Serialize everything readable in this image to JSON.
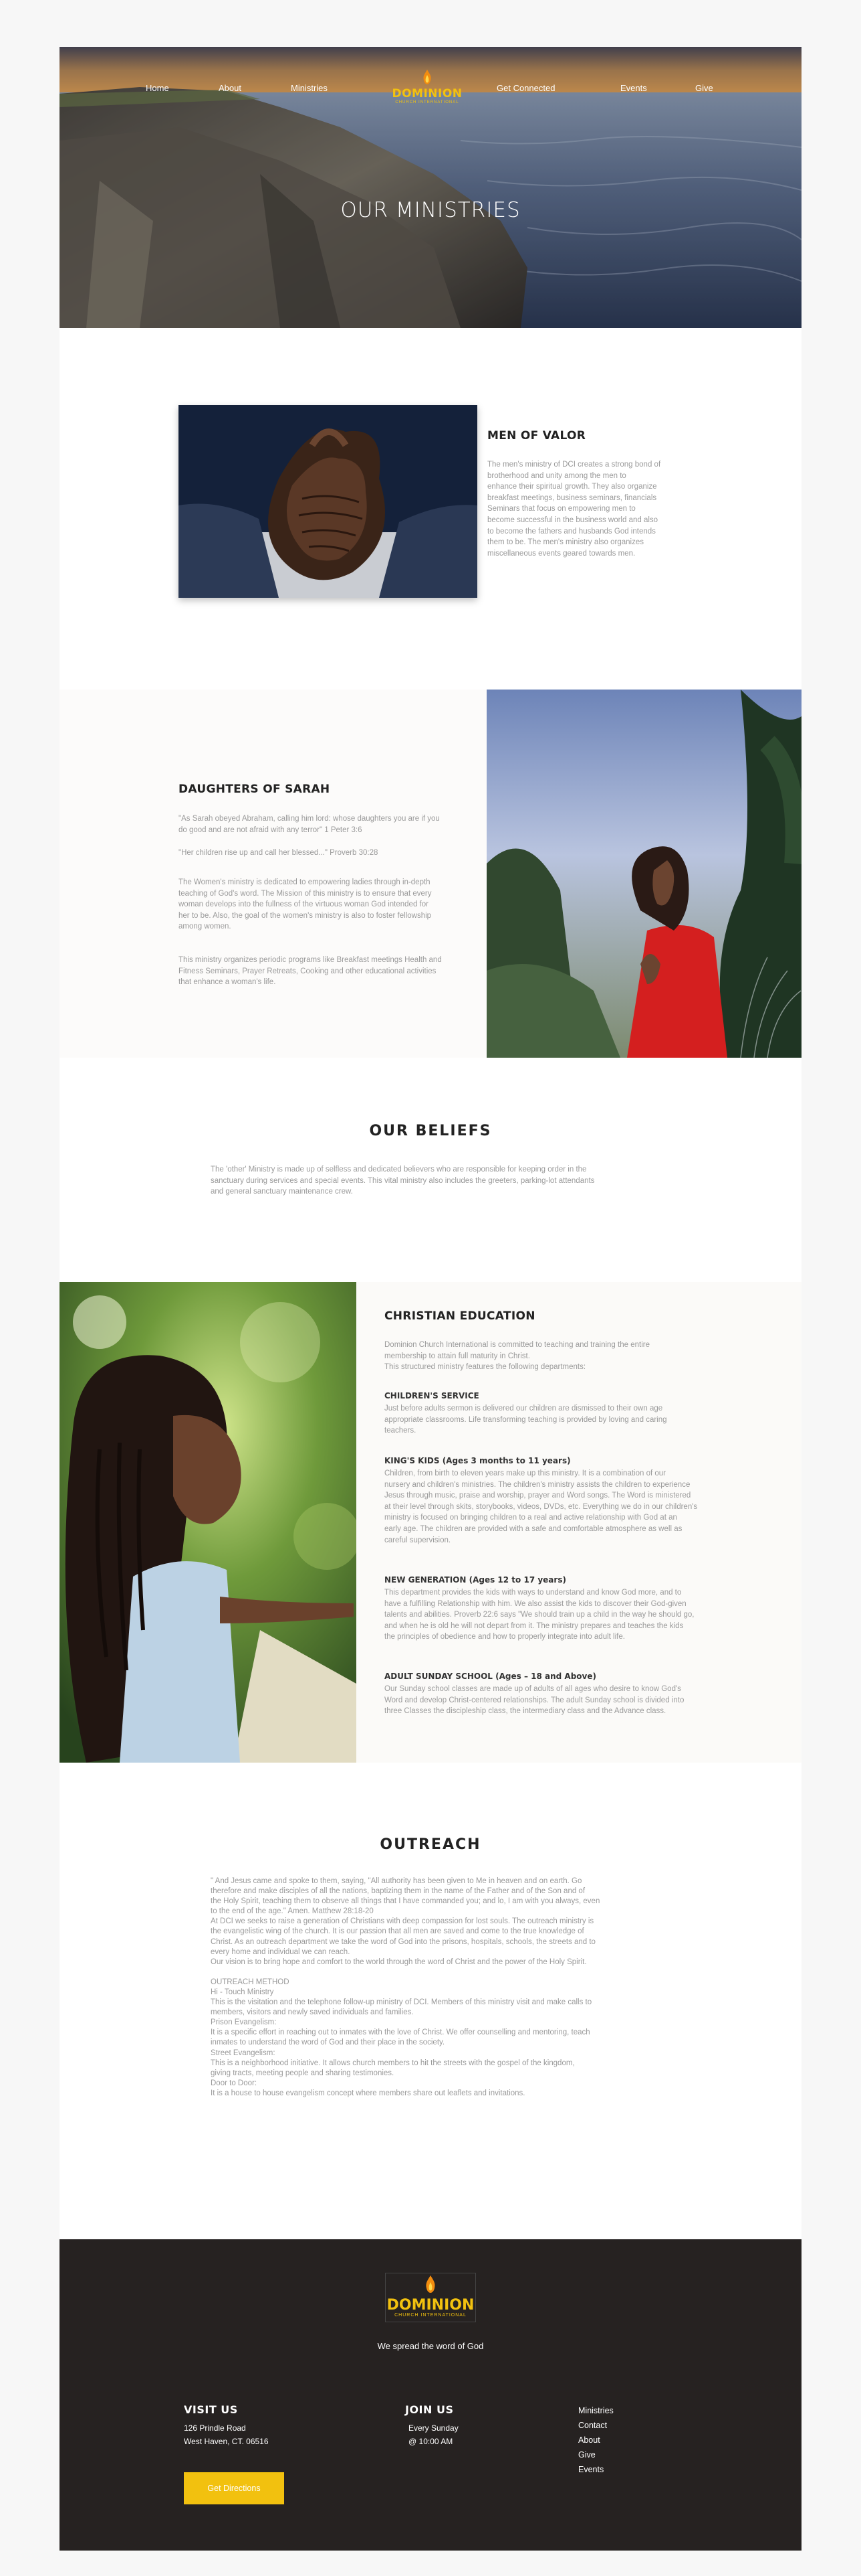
{
  "nav": {
    "items": [
      "Home",
      "About",
      "Ministries",
      "Get Connected",
      "Events",
      "Give"
    ]
  },
  "logo": {
    "word": "DOMINION",
    "sub": "CHURCH INTERNATIONAL"
  },
  "hero": {
    "title": "OUR MINISTRIES"
  },
  "men": {
    "title": "MEN OF VALOR",
    "lines": [
      "The men's ministry of DCI creates a strong bond of",
      "brotherhood and unity among the men to",
      "enhance their spiritual growth. They also organize",
      "breakfast meetings, business seminars, financials",
      "Seminars that focus on empowering men to",
      "become successful in the business world and also",
      "to become the fathers and husbands God intends",
      "them to be. The men's ministry also organizes",
      "miscellaneous events geared towards men."
    ]
  },
  "daughters": {
    "title": "DAUGHTERS OF SARAH",
    "quote1": [
      "\"As Sarah obeyed Abraham, calling him lord: whose daughters you are if you",
      "do good and are not afraid with any terror\" 1 Peter 3:6"
    ],
    "quote2": "\"Her children rise up and call her blessed...\" Proverb 30:28",
    "body1": [
      "The Women's ministry is dedicated to empowering ladies through in-depth",
      "teaching of God's word. The Mission of this ministry is to ensure that every",
      "woman develops into the fullness of the virtuous woman God intended for",
      "her to be. Also, the goal of the women's ministry is also to foster fellowship",
      "among women."
    ],
    "body2": [
      "This ministry organizes periodic programs like Breakfast meetings Health and",
      "Fitness Seminars, Prayer Retreats, Cooking and other educational activities",
      "that enhance a woman's life."
    ]
  },
  "beliefs": {
    "title": "OUR BELIEFS",
    "lines": [
      "The 'other' Ministry is made up of selfless and dedicated believers who are responsible for keeping order in the",
      "sanctuary during services and special events. This vital ministry also includes the greeters, parking-lot attendants",
      "and general sanctuary maintenance crew."
    ]
  },
  "education": {
    "title": "CHRISTIAN EDUCATION",
    "intro": [
      "Dominion Church International is committed to teaching and training the entire",
      "membership to attain full maturity in Christ.",
      "This structured ministry features the following departments:"
    ],
    "sections": [
      {
        "head": "CHILDREN'S SERVICE",
        "lines": [
          "Just before adults sermon is delivered our children are dismissed to their own age",
          "appropriate classrooms. Life transforming teaching is provided by loving and caring",
          "teachers."
        ]
      },
      {
        "head": "KING'S KIDS (Ages 3 months to 11 years)",
        "lines": [
          "Children, from birth to eleven years make up this ministry. It is a combination of our",
          "nursery and children's ministries. The children's ministry assists the children to experience",
          "Jesus through music, praise and worship, prayer and Word songs. The Word is ministered",
          "at their level through skits, storybooks, videos, DVDs, etc. Everything we do in our children's",
          "ministry is focused on bringing children to a real and active relationship with God at an",
          "early age. The children are provided with a safe and comfortable atmosphere as well as",
          "careful supervision."
        ]
      },
      {
        "head": "NEW GENERATION (Ages 12 to 17 years)",
        "lines": [
          "This department provides the kids with ways to understand and know God more, and to",
          "have a fulfilling Relationship with him. We also assist the kids to discover their God-given",
          "talents and abilities. Proverb 22:6 says \"We should train up a child in the way he should go,",
          "and when he is old he will not depart from it. The ministry prepares and teaches the kids",
          "the principles of obedience and how to properly integrate into adult life."
        ]
      },
      {
        "head": "ADULT SUNDAY SCHOOL (Ages – 18 and Above)",
        "lines": [
          "Our Sunday school classes are made up of adults of all ages who desire to know God's",
          "Word and develop Christ-centered relationships. The adult Sunday school is divided into",
          "three Classes the discipleship class, the intermediary class and the Advance class."
        ]
      }
    ]
  },
  "outreach": {
    "title": "OUTREACH",
    "lines": [
      "\" And Jesus came and spoke to them, saying, \"All authority has been given to Me in heaven and on earth. Go",
      "therefore and make disciples of all the nations, baptizing them in the name of the Father and of the Son and of",
      "the Holy Spirit, teaching them to observe all things that I have commanded you; and lo, I am with you always, even",
      "to the end of the age.\" Amen. Matthew 28:18-20",
      "At DCI we seeks to raise a generation of Christians with deep compassion for lost souls. The outreach ministry is",
      "the evangelistic wing of the church. It is our passion that all men are saved and come to the true knowledge of",
      "Christ. As an outreach department we take the word of God into the prisons, hospitals, schools, the streets and to",
      "every home and individual we can reach.",
      "Our vision is to bring hope and comfort to the world through the word of Christ and the power of the Holy Spirit.",
      "",
      "OUTREACH METHOD",
      "Hi - Touch Ministry",
      "This is the visitation and the telephone follow-up ministry of DCI. Members of this ministry visit and make calls to",
      "members, visitors and newly saved individuals and families.",
      "Prison Evangelism:",
      "It is a specific effort in reaching out to inmates with the love of Christ. We offer counselling and mentoring, teach",
      "inmates to understand the word of God and their place in the society.",
      "Street Evangelism:",
      "This is a neighborhood initiative. It allows church members to hit the streets with the gospel of the kingdom,",
      "giving tracts, meeting people and sharing testimonies.",
      "Door to Door:",
      "It is a house to house evangelism concept where members share out leaflets and invitations."
    ]
  },
  "footer": {
    "tagline": "We spread the word of God",
    "visit": {
      "head": "VISIT US",
      "lines": [
        "126 Prindle Road",
        "West Haven, CT. 06516"
      ]
    },
    "join": {
      "head": "JOIN US",
      "lines": [
        "Every Sunday",
        "@ 10:00 AM"
      ]
    },
    "links": [
      "Ministries",
      "Contact",
      "About",
      "Give",
      "Events"
    ],
    "button": "Get Directions"
  },
  "colors": {
    "accent": "#f2c10f",
    "footer_bg": "#262221",
    "body_text": "#9a9a9a"
  }
}
